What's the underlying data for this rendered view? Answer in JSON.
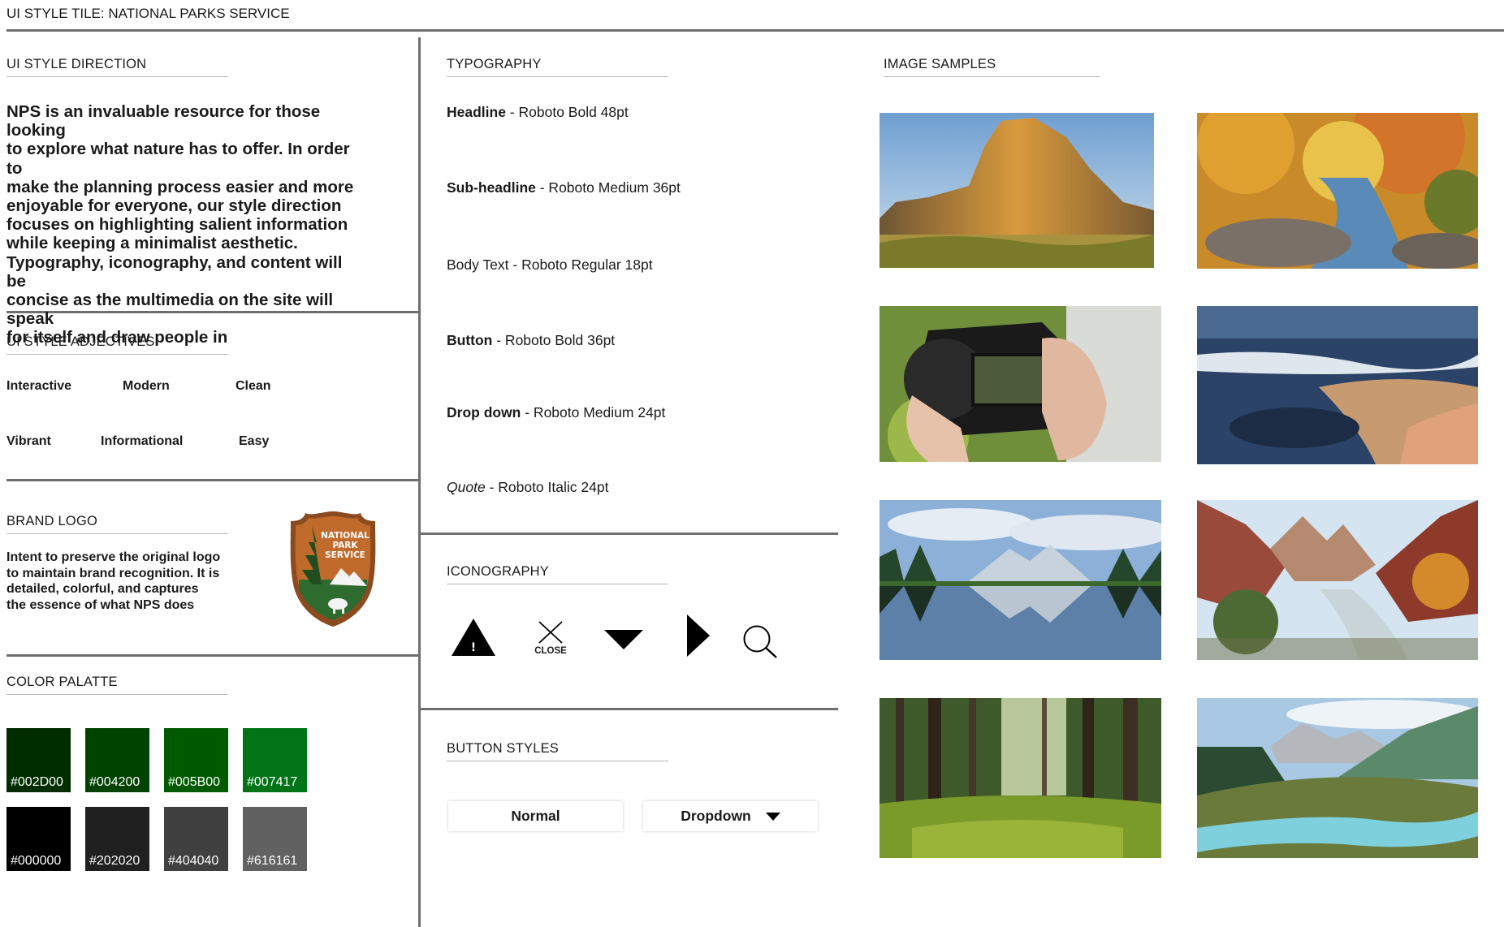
{
  "page": {
    "title": "UI STYLE TILE: NATIONAL PARKS SERVICE"
  },
  "direction": {
    "heading": "UI STYLE DIRECTION",
    "lines": [
      "NPS is an invaluable resource for those looking",
      "to explore what nature has to offer. In order to",
      "make the planning process easier and more",
      "enjoyable for everyone, our style direction",
      "focuses on highlighting salient information",
      "while keeping a minimalist aesthetic.",
      "Typography, iconography, and content will be",
      "concise as the multimedia on the site will speak",
      "for itself and draw people in"
    ]
  },
  "adjectives": {
    "heading": "UI STYLE ADJECTIVES",
    "items": [
      "Interactive",
      "Modern",
      "Clean",
      "Vibrant",
      "Informational",
      "Easy"
    ]
  },
  "brand": {
    "heading": "BRAND LOGO",
    "lines": [
      "Intent to preserve the original logo",
      "to maintain brand recognition. It is",
      "detailed, colorful, and captures",
      "the essence of what NPS does"
    ],
    "logo_text": [
      "NATIONAL",
      "PARK",
      "SERVICE"
    ]
  },
  "palette": {
    "heading": "COLOR PALATTE",
    "colors": [
      "#002D00",
      "#004200",
      "#005B00",
      "#007417",
      "#000000",
      "#202020",
      "#404040",
      "#616161"
    ],
    "labels": [
      "#002D00",
      "#004200",
      "#005B00",
      "#007417",
      "#000000",
      "#202020",
      "#404040",
      "#616161"
    ]
  },
  "typography": {
    "heading": "TYPOGRAPHY",
    "items": [
      {
        "name": "Headline",
        "spec": " - Roboto Bold 48pt"
      },
      {
        "name": "Sub-headline",
        "spec": " - Roboto Medium 36pt"
      },
      {
        "name": "Body Text",
        "spec": " - Roboto Regular 18pt"
      },
      {
        "name": "Button",
        "spec": " - Roboto Bold 36pt"
      },
      {
        "name": "Drop down",
        "spec": " - Roboto Medium 24pt"
      },
      {
        "name": "Quote",
        "spec": " - Roboto Italic 24pt"
      }
    ]
  },
  "iconography": {
    "heading": "ICONOGRAPHY",
    "icons": [
      "warning-icon",
      "close-icon",
      "triangle-down-icon",
      "triangle-right-icon",
      "search-icon"
    ],
    "close_label": "CLOSE",
    "warning_mark": "!"
  },
  "buttons": {
    "heading": "BUTTON STYLES",
    "normal": "Normal",
    "dropdown": "Dropdown"
  },
  "images": {
    "heading": "IMAGE SAMPLES",
    "items": [
      "rock-cliff",
      "autumn-stream",
      "camera",
      "rocky-coast",
      "mountain-lake",
      "canyon-river",
      "forest",
      "mountain-river"
    ]
  }
}
